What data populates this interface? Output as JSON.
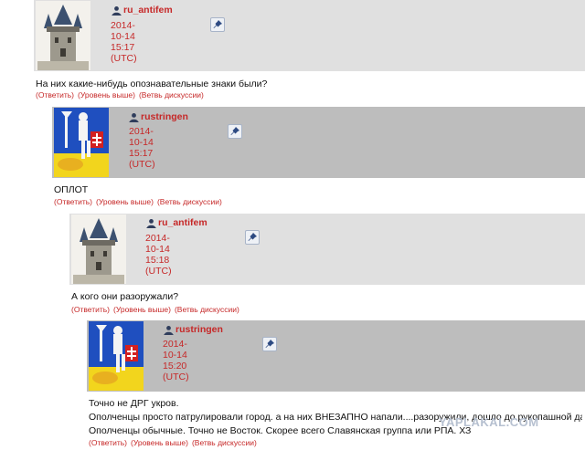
{
  "comments": [
    {
      "username": "ru_antifem",
      "timestamp": "2014-10-14 15:17 (UTC)",
      "body": [
        "На них какие-нибудь опознавательные знаки были?"
      ],
      "links": [
        "(Ответить)",
        "(Уровень выше)",
        "(Ветвь дискуссии)"
      ]
    },
    {
      "username": "rustringen",
      "timestamp": "2014-10-14 15:17 (UTC)",
      "body": [
        "ОПЛОТ"
      ],
      "links": [
        "(Ответить)",
        "(Уровень выше)",
        "(Ветвь дискуссии)"
      ]
    },
    {
      "username": "ru_antifem",
      "timestamp": "2014-10-14 15:18 (UTC)",
      "body": [
        "А кого они разоружали?"
      ],
      "links": [
        "(Ответить)",
        "(Уровень выше)",
        "(Ветвь дискуссии)"
      ]
    },
    {
      "username": "rustringen",
      "timestamp": "2014-10-14 15:20 (UTC)",
      "body": [
        "Точно не ДРГ укров.",
        "Ополченцы просто патрулировали город. а на них ВНЕЗАПНО напали....разоружили, дошло до рукопашной даже",
        "Ополченцы обычные. Точно не Восток. Скорее всего Славянская группа или РПА. ХЗ"
      ],
      "links": [
        "(Ответить)",
        "(Уровень выше)",
        "(Ветвь дискуссии)"
      ]
    }
  ],
  "watermark": "YAPLAKAL.COM",
  "colors": {
    "header_bg_light": "#e0e0e0",
    "header_bg_dark": "#bdbdbd",
    "accent_red": "#c62828"
  }
}
